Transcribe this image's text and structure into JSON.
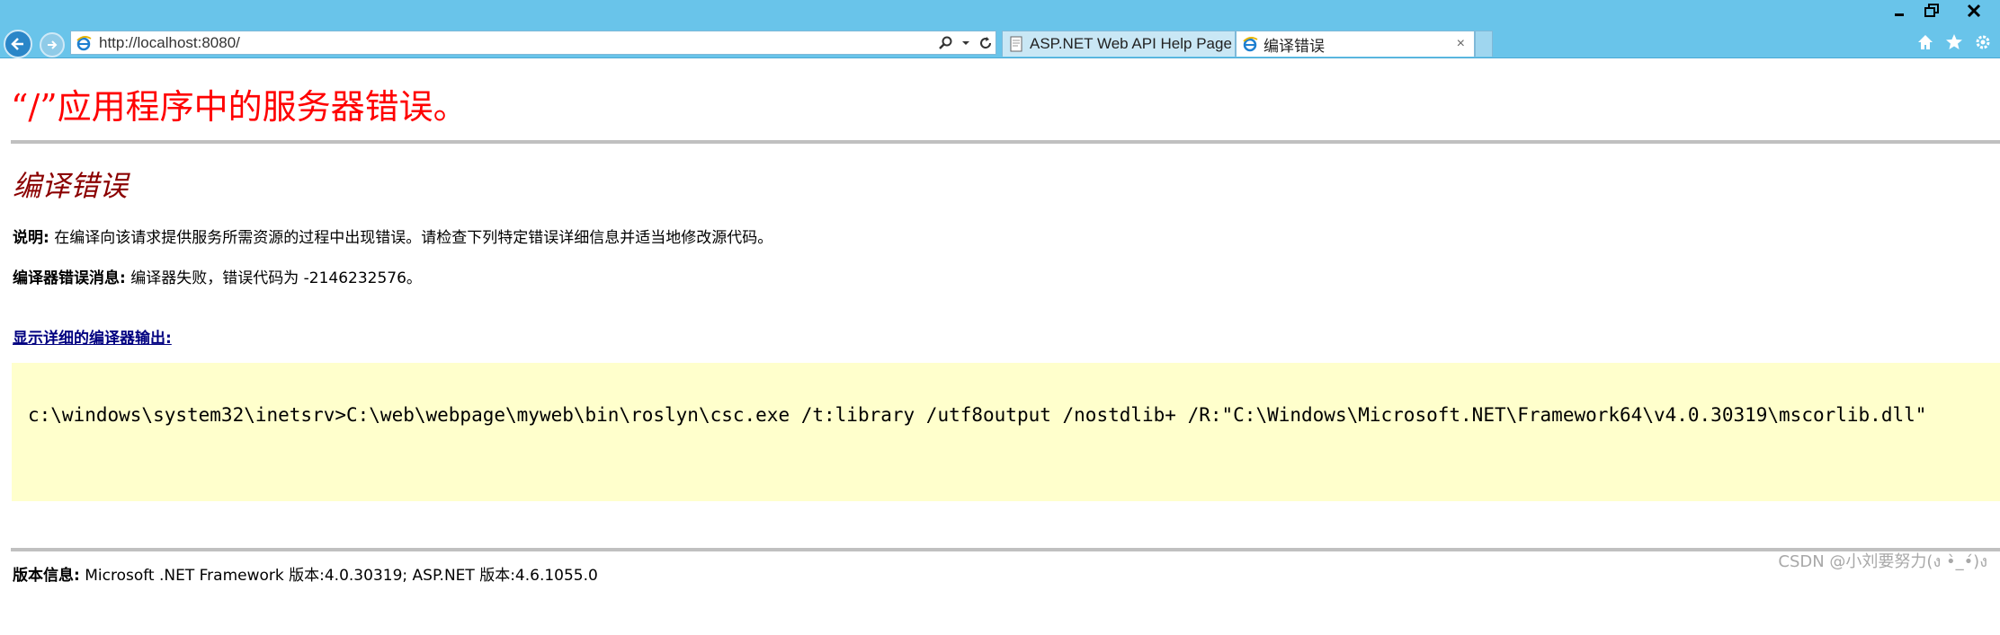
{
  "browser": {
    "url": "http://localhost:8080/",
    "tabs": [
      {
        "label": "ASP.NET Web API Help Page",
        "active": false
      },
      {
        "label": "编译错误",
        "active": true
      }
    ],
    "close_glyph": "×"
  },
  "page": {
    "title": "“/”应用程序中的服务器错误。",
    "subtitle": "编译错误",
    "description_label": "说明:",
    "description_text": " 在编译向该请求提供服务所需资源的过程中出现错误。请检查下列特定错误详细信息并适当地修改源代码。",
    "compiler_error_label": "编译器错误消息:",
    "compiler_error_text": " 编译器失败，错误代码为 -2146232576。",
    "show_output_link": "显示详细的编译器输出:",
    "compiler_output": "c:\\windows\\system32\\inetsrv>C:\\web\\webpage\\myweb\\bin\\roslyn\\csc.exe /t:library /utf8output /nostdlib+ /R:\"C:\\Windows\\Microsoft.NET\\Framework64\\v4.0.30319\\mscorlib.dll\"",
    "version_label": "版本信息:",
    "version_text": " Microsoft .NET Framework 版本:4.0.30319; ASP.NET 版本:4.6.1055.0"
  },
  "watermark": "CSDN @小刘要努力(ง •̀_•́)ง",
  "colors": {
    "chrome": "#69c4ea",
    "title_red": "#ff0000",
    "subtitle_maroon": "#8b0000",
    "link_navy": "#000080",
    "code_bg": "#ffffcc"
  },
  "icons": [
    "back-arrow-icon",
    "forward-arrow-icon",
    "ie-page-icon",
    "search-icon",
    "dropdown-icon",
    "refresh-icon",
    "home-icon",
    "favorites-star-icon",
    "gear-icon",
    "minimize-icon",
    "restore-icon",
    "close-icon"
  ]
}
